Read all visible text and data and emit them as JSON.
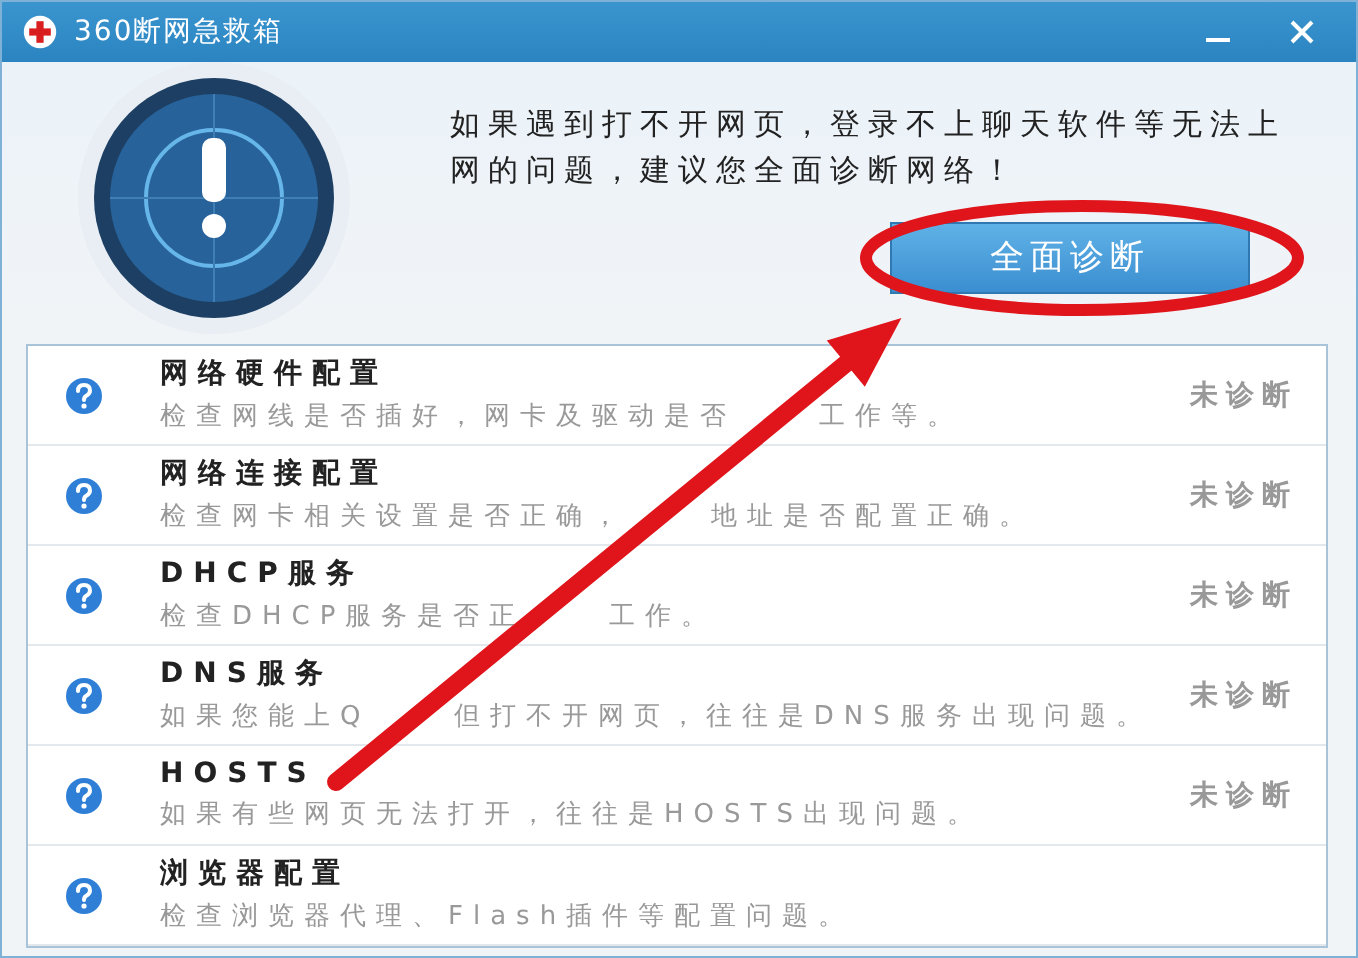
{
  "window": {
    "title": "360断网急救箱"
  },
  "header": {
    "message": "如果遇到打不开网页，登录不上聊天软件等无法上网的问题，建议您全面诊断网络！",
    "button": "全面诊断"
  },
  "items": [
    {
      "title": "网络硬件配置",
      "description": [
        "检查网线是否插好，网卡及驱动是否",
        "工作等。"
      ],
      "status": "未诊断"
    },
    {
      "title": "网络连接配置",
      "description": [
        "检查网卡相关设置是否正确，",
        "地址是否配置正确。"
      ],
      "status": "未诊断"
    },
    {
      "title": "DHCP服务",
      "description": [
        "检查DHCP服务是否正",
        "工作。"
      ],
      "status": "未诊断"
    },
    {
      "title": "DNS服务",
      "description": [
        "如果您能上Q",
        "但打不开网页，往往是DNS服务出现问题。"
      ],
      "status": "未诊断"
    },
    {
      "title": "HOSTS",
      "description": [
        "如果有些网页无法打开，往往是HOSTS出现问题。"
      ],
      "status": "未诊断"
    },
    {
      "title": "浏览器配置",
      "description": [
        "检查浏览器代理、Flash插件等配置问题。"
      ]
    }
  ]
}
